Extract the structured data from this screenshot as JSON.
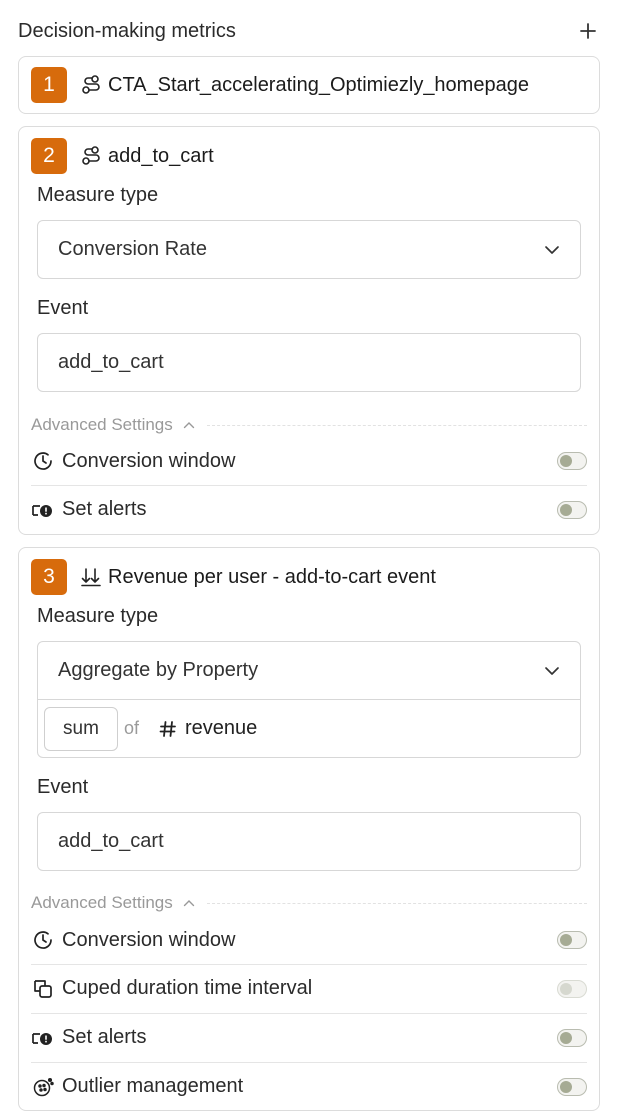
{
  "header": {
    "title": "Decision-making metrics"
  },
  "metrics": [
    {
      "number": "1",
      "name": "CTA_Start_accelerating_Optimiezly_homepage",
      "icon": "conversion-path-icon"
    },
    {
      "number": "2",
      "name": "add_to_cart",
      "icon": "conversion-path-icon",
      "measure_type_label": "Measure type",
      "measure_type": "Conversion Rate",
      "event_label": "Event",
      "event": "add_to_cart",
      "advanced_label": "Advanced Settings",
      "settings": [
        {
          "label": "Conversion window",
          "icon": "clock-icon",
          "enabled": false
        },
        {
          "label": "Set alerts",
          "icon": "alert-icon",
          "enabled": false
        }
      ]
    },
    {
      "number": "3",
      "name": "Revenue per user - add-to-cart event",
      "icon": "double-arrow-down-icon",
      "measure_type_label": "Measure type",
      "measure_type": "Aggregate by Property",
      "aggregate": "sum",
      "of": "of",
      "property": "revenue",
      "event_label": "Event",
      "event": "add_to_cart",
      "advanced_label": "Advanced Settings",
      "settings": [
        {
          "label": "Conversion window",
          "icon": "clock-icon",
          "enabled": false
        },
        {
          "label": "Cuped duration time interval",
          "icon": "copy-squares-icon",
          "enabled": false,
          "disabled": true
        },
        {
          "label": "Set alerts",
          "icon": "alert-icon",
          "enabled": false
        },
        {
          "label": "Outlier management",
          "icon": "outlier-icon",
          "enabled": false
        }
      ]
    }
  ],
  "colors": {
    "badge": "#d76b0c",
    "border": "#dcdcdc",
    "toggle_knob": "#a6ab94"
  }
}
